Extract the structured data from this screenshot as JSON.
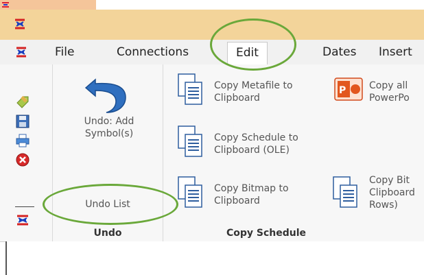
{
  "app": {
    "title": ""
  },
  "menu": {
    "items": [
      "File",
      "Connections",
      "Edit",
      "Dates",
      "Insert"
    ],
    "active": "Edit"
  },
  "ribbon": {
    "undo_group": {
      "undo_label": "Undo: Add\nSymbol(s)",
      "undo_list_label": "Undo List",
      "group_title": "Undo"
    },
    "copy_group": {
      "copy_metafile": "Copy Metafile to\nClipboard",
      "copy_all": "Copy all\nPowerPo",
      "copy_schedule": "Copy Schedule to\nClipboard (OLE)",
      "copy_bitmap": "Copy Bitmap to\nClipboard",
      "copy_bitmap_rows": "Copy Bit\nClipboard\nRows)",
      "group_title": "Copy Schedule"
    }
  },
  "colors": {
    "title_bg": "#f3d49a",
    "menu_bg": "#f1f1f1",
    "ribbon_bg": "#f7f7f7",
    "callout": "#6aa83a"
  },
  "icons": {
    "qat": [
      "tag-icon",
      "save-icon",
      "print-icon",
      "close-icon",
      "app-logo-icon"
    ],
    "undo": "undo-arrow-icon"
  }
}
